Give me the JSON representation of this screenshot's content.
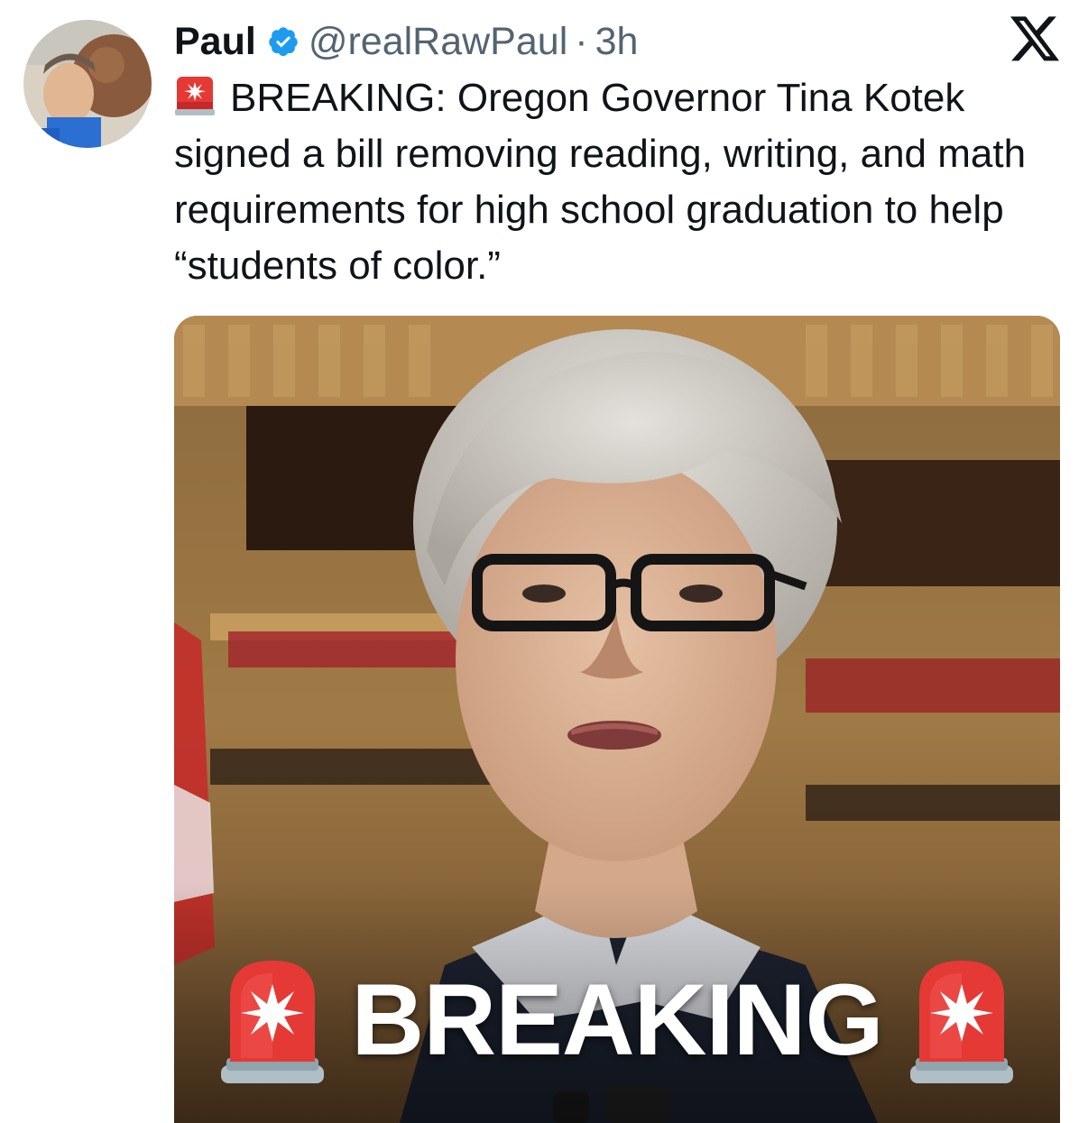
{
  "tweet": {
    "author": {
      "display_name": "Paul",
      "handle": "@realRawPaul",
      "verified": true
    },
    "separator": "·",
    "time": "3h",
    "text": "BREAKING: Oregon Governor Tina Kotek signed a bill removing reading, writing, and math requirements for high school graduation to help “students of color.”",
    "emoji_prefix": "police-car-light-icon",
    "media": {
      "caption": "BREAKING"
    }
  },
  "icons": {
    "verified": "verified-badge-icon",
    "platform": "x-logo-icon"
  },
  "colors": {
    "verified_blue": "#1d9bf0",
    "secondary_text": "#536471",
    "siren_red": "#e53935"
  }
}
